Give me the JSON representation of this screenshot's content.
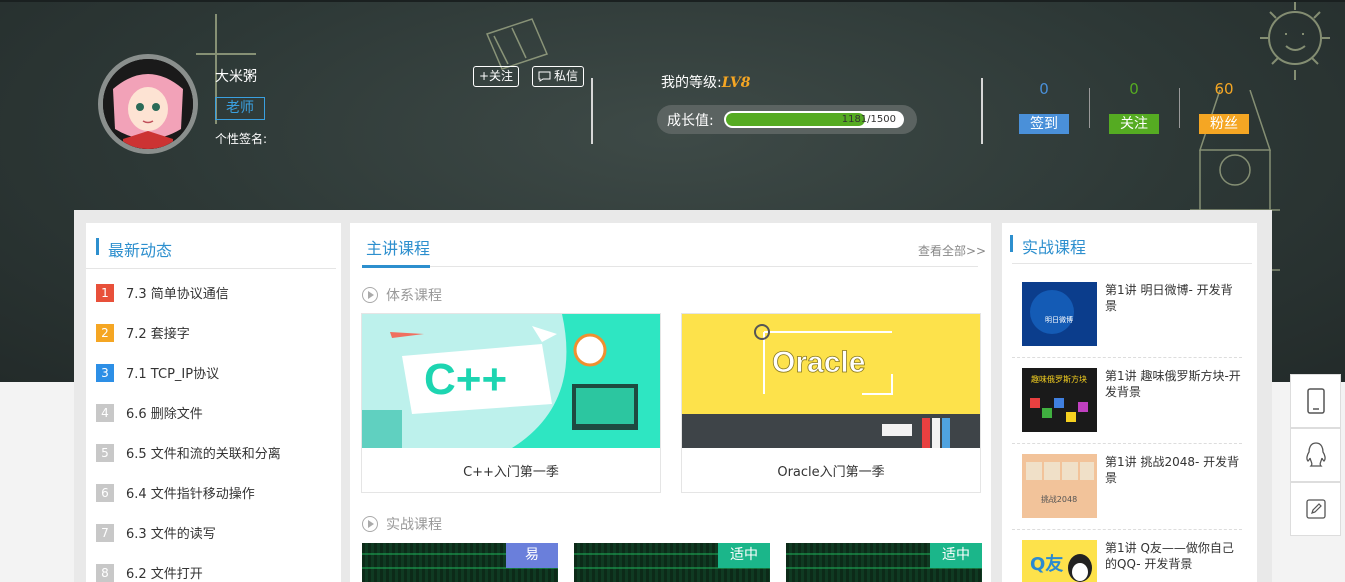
{
  "profile": {
    "name": "大米粥",
    "role": "老师",
    "signature_label": "个性签名:",
    "follow_button": "+关注",
    "message_button": "私信"
  },
  "level": {
    "label": "我的等级:",
    "value": "LV8",
    "growth_label": "成长值:",
    "growth_text": "1181/1500",
    "growth_progress": 0.787
  },
  "stats": [
    {
      "value": "0",
      "label": "签到",
      "color": "#4a90d9",
      "num_color": "#4a90d9"
    },
    {
      "value": "0",
      "label": "关注",
      "color": "#55ab22",
      "num_color": "#55ab22"
    },
    {
      "value": "60",
      "label": "粉丝",
      "color": "#f5a623",
      "num_color": "#f5a623"
    }
  ],
  "news": {
    "title": "最新动态",
    "items": [
      {
        "num": "1",
        "text": "7.3 简单协议通信",
        "color": "#e8503a"
      },
      {
        "num": "2",
        "text": "7.2 套接字",
        "color": "#f5a623"
      },
      {
        "num": "3",
        "text": "7.1 TCP_IP协议",
        "color": "#2d8fe6"
      },
      {
        "num": "4",
        "text": "6.6 删除文件",
        "color": "#c8c8c8"
      },
      {
        "num": "5",
        "text": "6.5 文件和流的关联和分离",
        "color": "#c8c8c8"
      },
      {
        "num": "6",
        "text": "6.4 文件指针移动操作",
        "color": "#c8c8c8"
      },
      {
        "num": "7",
        "text": "6.3 文件的读写",
        "color": "#c8c8c8"
      },
      {
        "num": "8",
        "text": "6.2 文件打开",
        "color": "#c8c8c8"
      }
    ]
  },
  "main": {
    "title": "主讲课程",
    "view_all": "查看全部>>",
    "system_title": "体系课程",
    "practice_title": "实战课程",
    "system_courses": [
      {
        "title": "C++入门第一季",
        "banner": "C++"
      },
      {
        "title": "Oracle入门第一季",
        "banner": "Oracle"
      }
    ],
    "practice_tags": [
      {
        "label": "易",
        "color": "#6a7fdb"
      },
      {
        "label": "适中",
        "color": "#1bb68a"
      },
      {
        "label": "适中",
        "color": "#1bb68a"
      }
    ]
  },
  "practice": {
    "title": "实战课程",
    "items": [
      {
        "text": "第1讲 明日微博- 开发背景",
        "thumb": "明日微博"
      },
      {
        "text": "第1讲 趣味俄罗斯方块-开发背景",
        "thumb": "趣味俄罗斯方块"
      },
      {
        "text": "第1讲 挑战2048- 开发背景",
        "thumb": "挑战2048"
      },
      {
        "text": "第1讲 Q友——做你自己的QQ- 开发背景",
        "thumb": "Q友"
      }
    ]
  }
}
